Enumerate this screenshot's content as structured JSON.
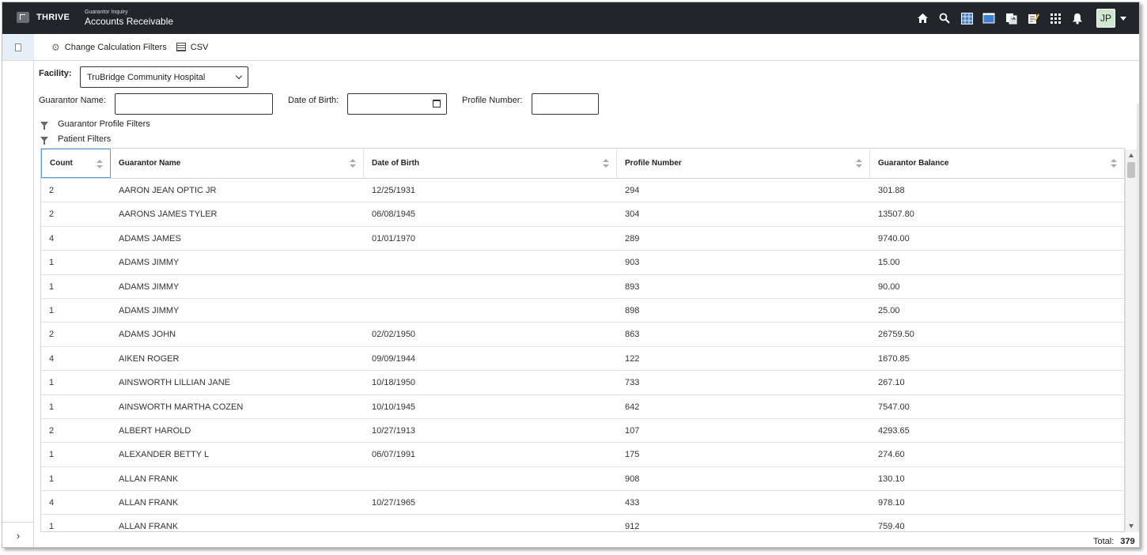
{
  "header": {
    "brand": "THRIVE",
    "module_subtitle": "Guarantor Inquiry",
    "module_title": "Accounts Receivable",
    "icons": [
      "home-icon",
      "search-icon",
      "calendar-grid-icon",
      "window-icon",
      "document-transfer-icon",
      "notepad-icon",
      "apps-grid-icon",
      "bell-icon"
    ],
    "user_initials": "JP"
  },
  "toolbar": {
    "change_filters_label": "Change Calculation Filters",
    "csv_label": "CSV"
  },
  "filters": {
    "facility_label": "Facility:",
    "facility_value": "TruBridge Community Hospital",
    "guarantor_name_label": "Guarantor Name:",
    "guarantor_name_value": "",
    "dob_label": "Date of Birth:",
    "dob_value": "",
    "profile_number_label": "Profile Number:",
    "profile_number_value": "",
    "guarantor_profile_filters": "Guarantor Profile Filters",
    "patient_filters": "Patient Filters"
  },
  "table": {
    "columns": [
      "Count",
      "Guarantor Name",
      "Date of Birth",
      "Profile Number",
      "Guarantor Balance"
    ],
    "rows": [
      {
        "count": "2",
        "name": "AARON JEAN OPTIC JR",
        "dob": "12/25/1931",
        "profile": "294",
        "balance": "301.88"
      },
      {
        "count": "2",
        "name": "AARONS JAMES TYLER",
        "dob": "06/08/1945",
        "profile": "304",
        "balance": "13507.80"
      },
      {
        "count": "4",
        "name": "ADAMS JAMES",
        "dob": "01/01/1970",
        "profile": "289",
        "balance": "9740.00"
      },
      {
        "count": "1",
        "name": "ADAMS JIMMY",
        "dob": "",
        "profile": "903",
        "balance": "15.00"
      },
      {
        "count": "1",
        "name": "ADAMS JIMMY",
        "dob": "",
        "profile": "893",
        "balance": "90.00"
      },
      {
        "count": "1",
        "name": "ADAMS JIMMY",
        "dob": "",
        "profile": "898",
        "balance": "25.00"
      },
      {
        "count": "2",
        "name": "ADAMS JOHN",
        "dob": "02/02/1950",
        "profile": "863",
        "balance": "26759.50"
      },
      {
        "count": "4",
        "name": "AIKEN ROGER",
        "dob": "09/09/1944",
        "profile": "122",
        "balance": "1670.85"
      },
      {
        "count": "1",
        "name": "AINSWORTH LILLIAN JANE",
        "dob": "10/18/1950",
        "profile": "733",
        "balance": "267.10"
      },
      {
        "count": "1",
        "name": "AINSWORTH MARTHA COZEN",
        "dob": "10/10/1945",
        "profile": "642",
        "balance": "7547.00"
      },
      {
        "count": "2",
        "name": "ALBERT HAROLD",
        "dob": "10/27/1913",
        "profile": "107",
        "balance": "4293.65"
      },
      {
        "count": "1",
        "name": "ALEXANDER BETTY L",
        "dob": "06/07/1991",
        "profile": "175",
        "balance": "274.60"
      },
      {
        "count": "1",
        "name": "ALLAN FRANK",
        "dob": "",
        "profile": "908",
        "balance": "130.10"
      },
      {
        "count": "4",
        "name": "ALLAN FRANK",
        "dob": "10/27/1965",
        "profile": "433",
        "balance": "978.10"
      },
      {
        "count": "1",
        "name": "ALLAN FRANK",
        "dob": "",
        "profile": "912",
        "balance": "759.40"
      }
    ]
  },
  "footer": {
    "total_label": "Total:",
    "total_value": "379"
  }
}
